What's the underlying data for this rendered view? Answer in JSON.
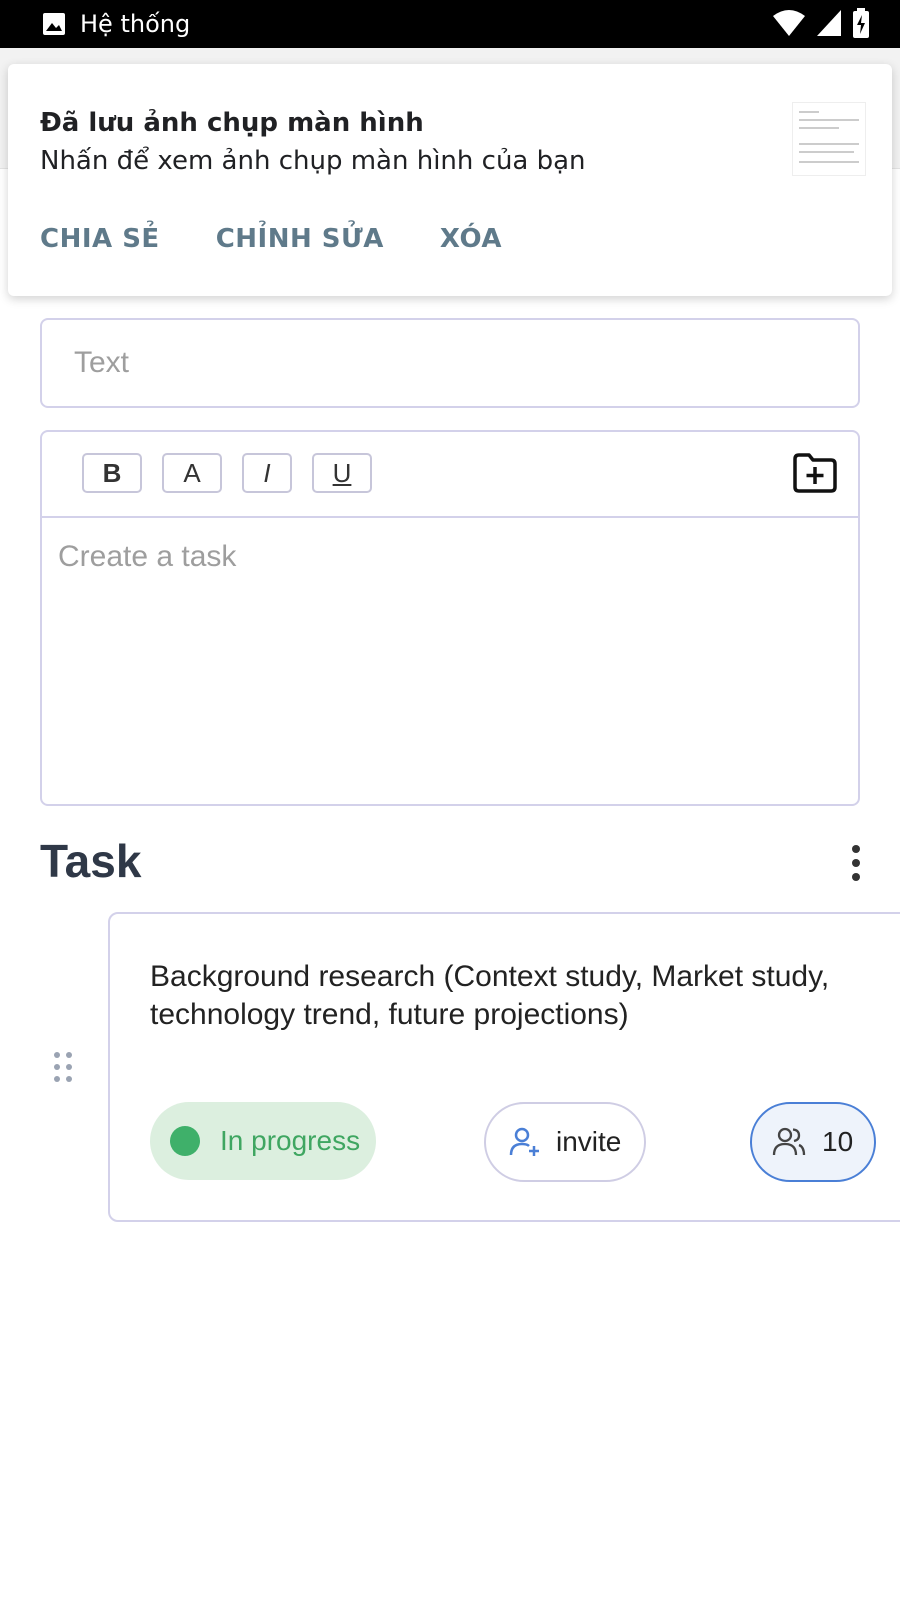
{
  "status_bar": {
    "app_label": "Hệ thống",
    "icons": [
      "image-icon",
      "wifi-icon",
      "signal-icon",
      "battery-icon"
    ]
  },
  "notification": {
    "title": "Đã lưu ảnh chụp màn hình",
    "text": "Nhấn để xem ảnh chụp màn hình của bạn",
    "actions": [
      "CHIA SẺ",
      "CHỈNH SỬA",
      "XÓA"
    ]
  },
  "form": {
    "text_placeholder": "Text",
    "toolbar": {
      "bold": "B",
      "color": "A",
      "italic": "I",
      "underline": "U"
    },
    "task_placeholder": "Create a task"
  },
  "section": {
    "title": "Task"
  },
  "task_card": {
    "description": "Background research (Context study, Market study, technology trend, future projections)",
    "status": "In progress",
    "invite_label": "invite",
    "member_count": "10"
  },
  "colors": {
    "status_green": "#3fb06a",
    "status_bg": "#dcefdf",
    "accent_blue": "#4a7fd6",
    "border": "#d3d1ea",
    "action_text": "#5f7a8a"
  }
}
